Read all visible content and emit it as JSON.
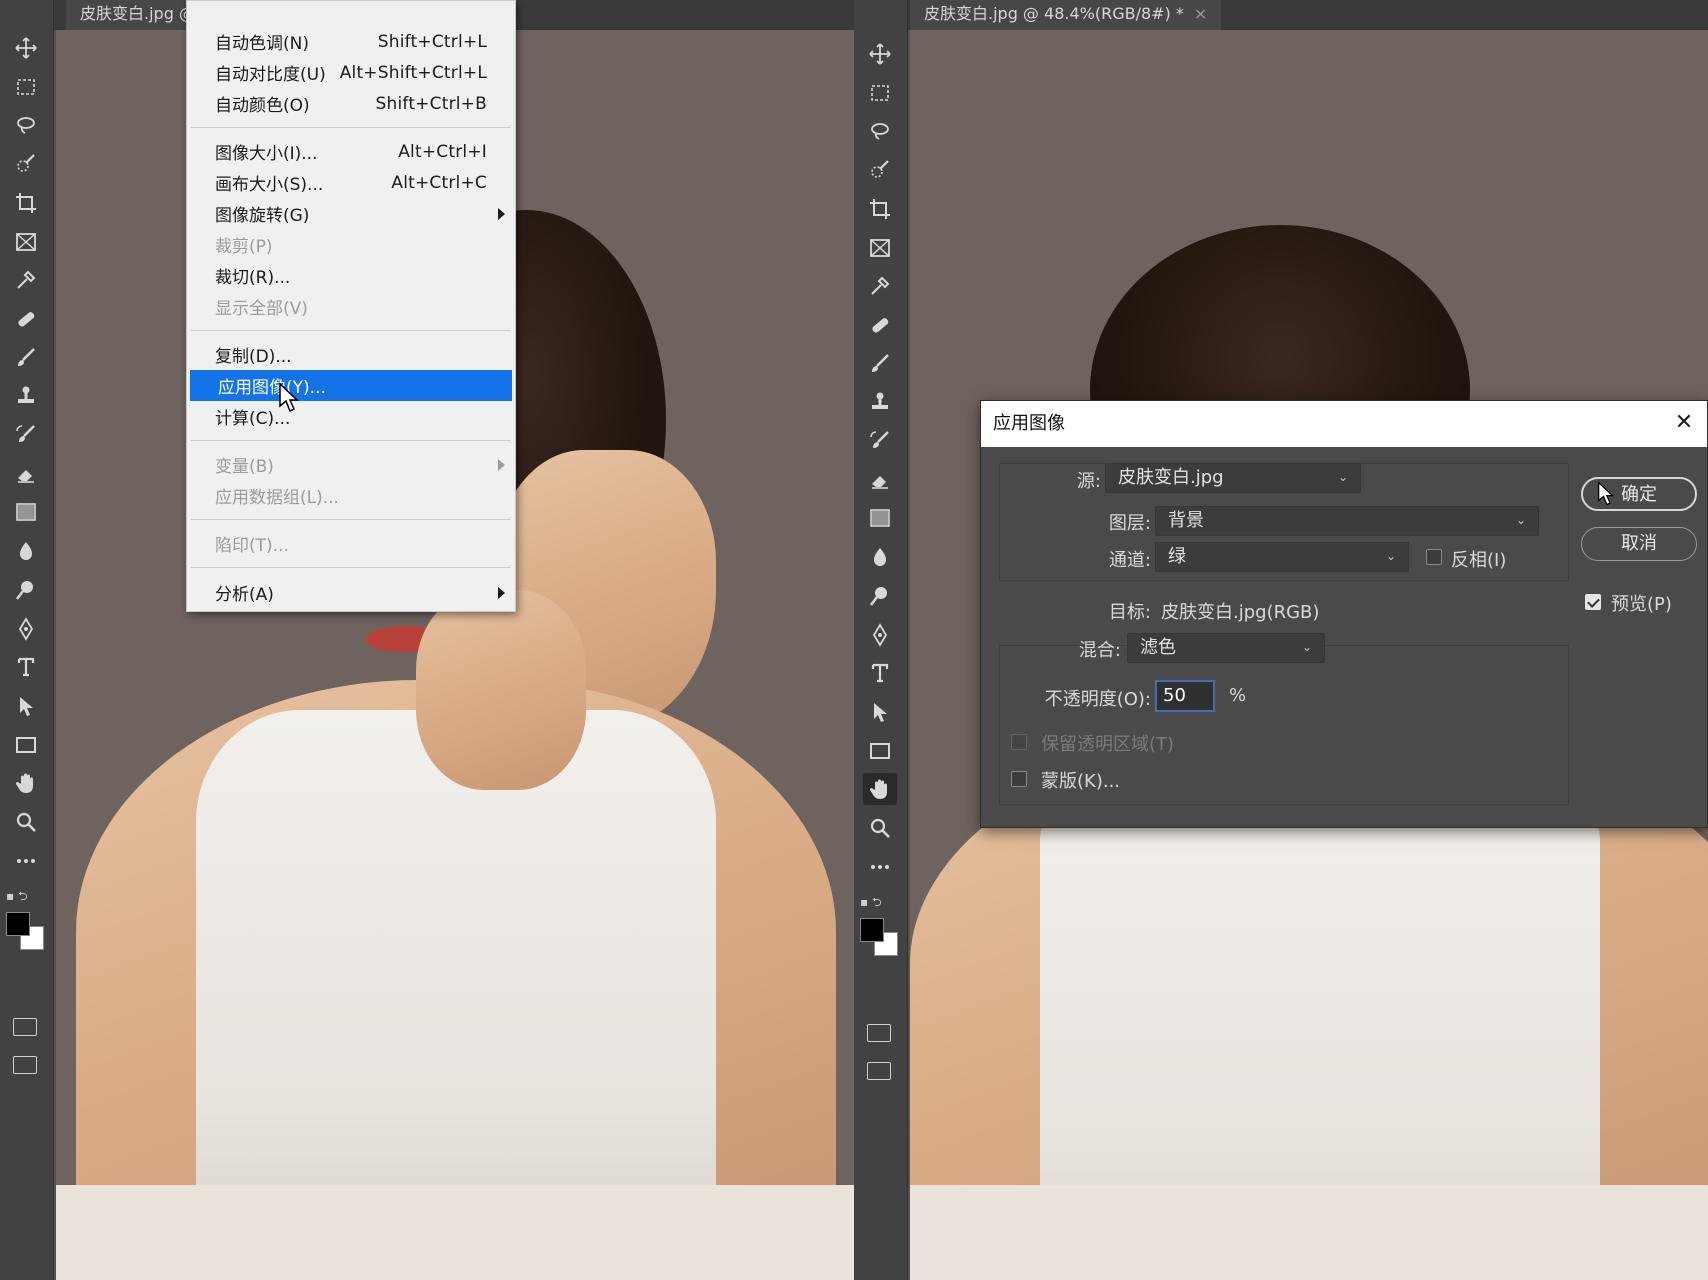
{
  "left_window": {
    "tab_title": "皮肤变白.jpg @"
  },
  "right_window": {
    "tab_title": "皮肤变白.jpg @ 48.4%(RGB/8#) *",
    "tab_close": "×"
  },
  "tools": [
    "move-icon",
    "marquee-icon",
    "lasso-icon",
    "quick-select-icon",
    "crop-icon",
    "frame-icon",
    "eyedropper-icon",
    "healing-icon",
    "brush-icon",
    "stamp-icon",
    "history-brush-icon",
    "eraser-icon",
    "gradient-icon",
    "blur-icon",
    "dodge-icon",
    "pen-icon",
    "type-icon",
    "path-select-icon",
    "rectangle-icon",
    "hand-icon",
    "zoom-icon",
    "more-icon"
  ],
  "image_menu": {
    "items": [
      {
        "label": "自动色调(N)",
        "shortcut": "Shift+Ctrl+L"
      },
      {
        "label": "自动对比度(U)",
        "shortcut": "Alt+Shift+Ctrl+L"
      },
      {
        "label": "自动颜色(O)",
        "shortcut": "Shift+Ctrl+B"
      },
      {
        "label": "图像大小(I)...",
        "shortcut": "Alt+Ctrl+I"
      },
      {
        "label": "画布大小(S)...",
        "shortcut": "Alt+Ctrl+C"
      },
      {
        "label": "图像旋转(G)"
      },
      {
        "label": "裁剪(P)"
      },
      {
        "label": "裁切(R)..."
      },
      {
        "label": "显示全部(V)"
      },
      {
        "label": "复制(D)..."
      },
      {
        "label": "应用图像(Y)..."
      },
      {
        "label": "计算(C)..."
      },
      {
        "label": "变量(B)"
      },
      {
        "label": "应用数据组(L)..."
      },
      {
        "label": "陷印(T)..."
      },
      {
        "label": "分析(A)"
      }
    ]
  },
  "apply_image_dialog": {
    "title": "应用图像",
    "close": "✕",
    "source_label": "源:",
    "source_value": "皮肤变白.jpg",
    "layer_label": "图层:",
    "layer_value": "背景",
    "channel_label": "通道:",
    "channel_value": "绿",
    "invert_label": "反相(I)",
    "target_label": "目标:",
    "target_value": "皮肤变白.jpg(RGB)",
    "blending_label": "混合:",
    "blending_value": "滤色",
    "opacity_label": "不透明度(O):",
    "opacity_value": "50",
    "opacity_unit": "%",
    "preserve_transparency_label": "保留透明区域(T)",
    "mask_label": "蒙版(K)...",
    "ok_label": "确定",
    "cancel_label": "取消",
    "preview_label": "预览(P)",
    "preview_checked": true,
    "invert_checked": false,
    "mask_checked": false
  },
  "colors": {
    "menu_highlight": "#1473e6",
    "foreground": "#000000",
    "background": "#ffffff"
  }
}
